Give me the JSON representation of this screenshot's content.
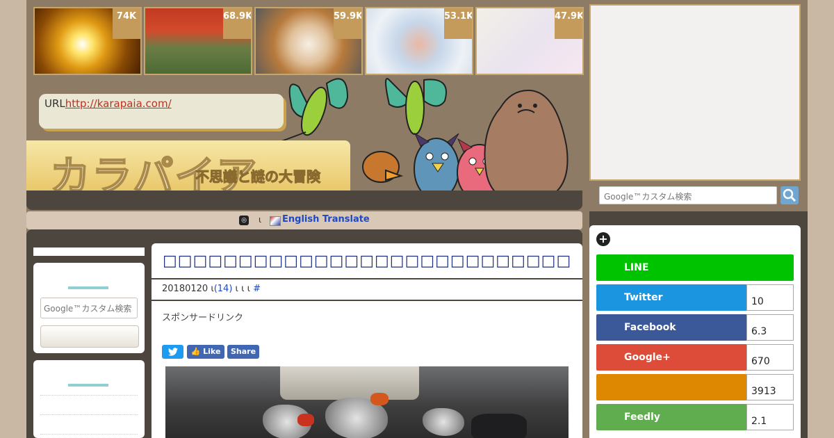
{
  "thumbnails": [
    {
      "count": "74K"
    },
    {
      "count": "68.9K"
    },
    {
      "count": "59.9K"
    },
    {
      "count": "53.1K"
    },
    {
      "count": "47.9K"
    }
  ],
  "header": {
    "url_label": "URL",
    "url": "http://karapaia.com/",
    "logo": "カラパイア",
    "tagline": "不思議と謎の大冒険"
  },
  "translate": {
    "separator": "ι",
    "label": "English Translate"
  },
  "right_search": {
    "placeholder": "Google™カスタム検索"
  },
  "left_search": {
    "placeholder": "Google™カスタム検索"
  },
  "article": {
    "title": "□□□□□□□□□□□□□□□□□□□□□□□□□□□□□□□□□□□□□□",
    "date": "20180120",
    "separator_a": "ι",
    "comments": "(14)",
    "separator_b": "ι ι ι",
    "hash": "#",
    "sponsor": "スポンサードリンク",
    "buttons": {
      "like": "Like",
      "share": "Share"
    }
  },
  "share_counts": [
    {
      "name": "LINE",
      "count": "",
      "color": "#00c300"
    },
    {
      "name": "Twitter",
      "count": "10",
      "color": "#1b95e0"
    },
    {
      "name": "Facebook",
      "count": "6.3",
      "color": "#3b5998"
    },
    {
      "name": "Google+",
      "count": "670",
      "color": "#dd4b39"
    },
    {
      "name": "",
      "count": "3913",
      "color": "#dd8800"
    },
    {
      "name": "Feedly",
      "count": "2.1",
      "color": "#6cc655"
    }
  ]
}
